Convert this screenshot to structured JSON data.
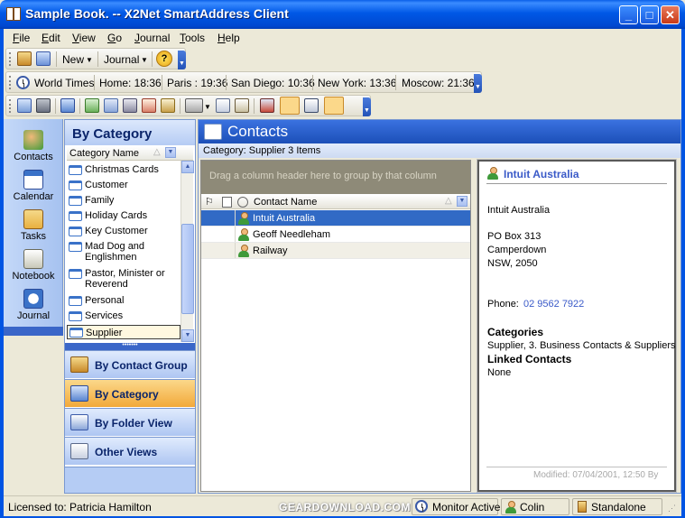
{
  "window": {
    "title": "Sample Book. -- X2Net SmartAddress Client",
    "min_glyph": "_",
    "max_glyph": "□",
    "close_glyph": "✕"
  },
  "menu": [
    "File",
    "Edit",
    "View",
    "Go",
    "Journal",
    "Tools",
    "Help"
  ],
  "toolbar1": {
    "new_label": "New",
    "journal_label": "Journal"
  },
  "worldtimes": {
    "label": "World Times",
    "cities": [
      "Home: 18:36",
      "Paris : 19:36",
      "San Diego: 10:36",
      "New York: 13:36",
      "Moscow: 21:36"
    ]
  },
  "nav": [
    "Contacts",
    "Calendar",
    "Tasks",
    "Notebook",
    "Journal"
  ],
  "category_panel": {
    "title": "By Category",
    "column": "Category Name",
    "items": [
      "Christmas Cards",
      "Customer",
      "Family",
      "Holiday Cards",
      "Key Customer",
      "Mad Dog and Englishmen",
      "Pastor, Minister or Reverend",
      "Personal",
      "Services",
      "Supplier"
    ],
    "selected": "Supplier"
  },
  "views": [
    "By Contact Group",
    "By Category",
    "By Folder View",
    "Other Views"
  ],
  "active_view": "By Category",
  "contacts": {
    "title": "Contacts",
    "subtitle": "Category: Supplier  3 Items",
    "group_hint": "Drag a column header here to group by that column",
    "column": "Contact Name",
    "rows": [
      "Intuit Australia",
      "Geoff Needleham",
      "Railway"
    ],
    "selected_row": "Intuit Australia"
  },
  "detail": {
    "name": "Intuit Australia",
    "company": "Intuit Australia",
    "address1": "PO Box 313",
    "address2": "Camperdown",
    "address3": "NSW,  2050",
    "phone_label": "Phone:",
    "phone": "02 9562 7922",
    "categories_label": "Categories",
    "categories": "Supplier, 3. Business Contacts & Suppliers",
    "linked_label": "Linked Contacts",
    "linked": "None",
    "modified": "Modified: 07/04/2001, 12:50 By"
  },
  "status": {
    "licensed": "Licensed to: Patricia Hamilton",
    "watermark": "GEARDOWNLOAD.COM",
    "monitor": "Monitor Active",
    "user": "Colin",
    "mode": "Standalone"
  },
  "colors": {
    "accent_blue": "#316ac5",
    "link_blue": "#3a5ac8",
    "active_view_orange": "#f2a93a"
  }
}
